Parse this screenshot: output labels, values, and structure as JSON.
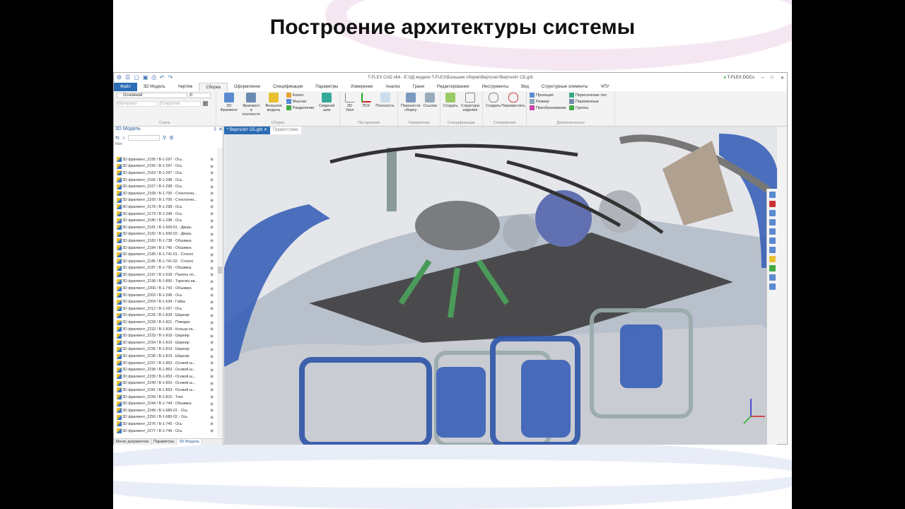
{
  "slide": {
    "title": "Построение архитектуры системы"
  },
  "app": {
    "window_title": "T-FLEX CAD x64 - E:\\3Д модели T-FLEX\\Большие сборки\\Вертолет\\Вертолёт СБ.grb",
    "docs_label": "T-FLEX DOCs",
    "tabs": [
      "Файл",
      "3D Модель",
      "Чертёж",
      "Сборка",
      "Оформление",
      "Спецификации",
      "Параметры",
      "Измерение",
      "Анализ",
      "Грани",
      "Редактирование",
      "Инструменты",
      "Вид",
      "Структурные элементы",
      "ЧПУ"
    ],
    "active_tab": "Сборка",
    "style_group": {
      "layer": "Основной",
      "layer_num": "0",
      "material": "Материал",
      "coating": "Покрытие",
      "label": "Стиль"
    },
    "assembly_group": {
      "b1": "3D Фрагмент",
      "b2": "Фрагмент в контексте",
      "b3": "Внешняя модель",
      "s1": "Копия",
      "s2": "Массив",
      "s3": "Разделение",
      "b4": "Сварной шов",
      "label": "Сборка"
    },
    "build_group": {
      "b1": "3D Узел",
      "b2": "ЛСК",
      "b3": "Плоскость",
      "label": "Построения"
    },
    "manage_group": {
      "b1": "Перенести сборку",
      "b2": "Ссылки",
      "label": "Управление"
    },
    "spec_group": {
      "b1": "Создать",
      "b2": "Структура изделия",
      "label": "Спецификации"
    },
    "mate_group": {
      "b1": "Создать",
      "b2": "Переместить",
      "label": "Сопряжения"
    },
    "extra_group": {
      "s1": "Проекция",
      "s2": "Размер",
      "s3": "Преобразование",
      "s4": "Пересечение тел",
      "s5": "Переменные",
      "s6": "Группы",
      "label": "Дополнительно"
    },
    "panel": {
      "title": "3D Модель",
      "col": "Имя",
      "bottom_tabs": [
        "Меню документов",
        "Параметры",
        "3D Модель"
      ]
    },
    "doc_tabs": [
      "* Вертолёт СБ.grb",
      "Приветствие"
    ],
    "tree": [
      "3D фрагмент_2155 / В-1-297 - Ось",
      "3D фрагмент_2156 / В-1-297 - Ось",
      "3D фрагмент_2163 / В-1-297 - Ось",
      "3D фрагмент_2166 / В-1-298 - Ось",
      "3D фрагмент_2167 / В-1-298 - Ось",
      "3D фрагмент_2168 / В-1-700 - Стеклоочи...",
      "3D фрагмент_2169 / В-1-700 - Стеклоочи...",
      "3D фрагмент_2178 / В-1-298 - Ось",
      "3D фрагмент_2179 / В-1-298 - Ось",
      "3D фрагмент_2180 / В-1-298 - Ось",
      "3D фрагмент_2181 / В-1-500-01 - Дверь",
      "3D фрагмент_2182 / В-1-500-02 - Дверь",
      "3D фрагмент_2183 / В-1-738 - Обшивка",
      "3D фрагмент_2184 / В-1-740 - Обшивка",
      "3D фрагмент_2185 / В-1-741-01 - Стекло",
      "3D фрагмент_2186 / В-1-741-02 - Стекло",
      "3D фрагмент_2187 / В-1-730 - Обшивка",
      "3D фрагмент_2197 / В-1-018 - Панель по...",
      "3D фрагмент_2198 / В-1-850 - Тарелка ав...",
      "3D фрагмент_2200 / В-1-743 - Обшивка",
      "3D фрагмент_2203 / В-1-298 - Ось",
      "3D фрагмент_2204 / В-1-634 - Гайка",
      "3D фрагмент_2212 / В-1-297 - Ось",
      "3D фрагмент_2226 / В-1-828 - Шарнир",
      "3D фрагмент_2228 / В-1-821 - Поводок",
      "3D фрагмент_2232 / В-1-818 - Кольцо ка...",
      "3D фрагмент_2233 / В-1-819 - Шарнир",
      "3D фрагмент_2234 / В-1-819 - Шарнир",
      "3D фрагмент_2235 / В-1-819 - Шарнир",
      "3D фрагмент_2236 / В-1-819 - Шарнир",
      "3D фрагмент_2237 / В-1-853 - Осевой ш...",
      "3D фрагмент_2238 / В-1-853 - Осевой ш...",
      "3D фрагмент_2239 / В-1-853 - Осевой ш...",
      "3D фрагмент_2240 / В-1-853 - Осевой ш...",
      "3D фрагмент_2241 / В-1-853 - Осевой ш...",
      "3D фрагмент_2243 / В-1-815 - Тяга",
      "3D фрагмент_2244 / В-1-744 - Обшивка",
      "3D фрагмент_2249 / В-1-680-01 - Ось",
      "3D фрагмент_2250 / В-1-680-02 - Ось",
      "3D фрагмент_2276 / В-1-745 - Ось",
      "3D фрагмент_2277 / В-1-745 - Ось"
    ]
  }
}
